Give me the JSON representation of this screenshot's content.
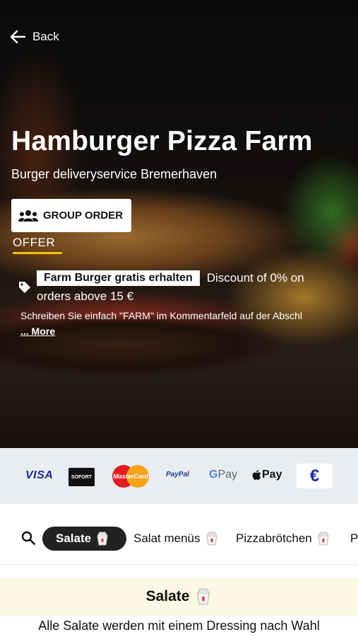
{
  "header": {
    "back_label": "Back"
  },
  "restaurant": {
    "name": "Hamburger Pizza Farm",
    "subtitle": "Burger deliveryservice Bremerhaven"
  },
  "actions": {
    "group_order_label": "GROUP ORDER"
  },
  "offer": {
    "tab_label": "OFFER",
    "badge": "Farm Burger gratis erhalten",
    "discount_text": "Discount of 0% on",
    "condition_text": "orders above 15 €",
    "description": "Schreiben Sie einfach \"FARM\" im Kommentarfeld auf der Abschl",
    "more_label": "... More"
  },
  "payments": {
    "visa": "VISA",
    "sofort": "SOFORT",
    "mastercard": "MasterCard",
    "paypal": "PayPal",
    "gpay": "Pay",
    "applepay": "Pay",
    "cash": "€"
  },
  "categories": [
    {
      "label": "Salate",
      "active": true
    },
    {
      "label": "Salat menüs",
      "active": false
    },
    {
      "label": "Pizzabrötchen",
      "active": false
    },
    {
      "label": "P",
      "active": false
    }
  ],
  "section": {
    "title": "Salate",
    "description": "Alle Salate werden mit einem Dressing nach Wahl"
  },
  "colors": {
    "accent_yellow": "#f4c400",
    "active_pill": "#222222",
    "payment_strip": "#e9edf2",
    "section_bg": "#fdf8e4"
  },
  "icons": [
    "arrow-left-icon",
    "group-icon",
    "tag-icon",
    "search-icon",
    "takeout-box-icon"
  ]
}
